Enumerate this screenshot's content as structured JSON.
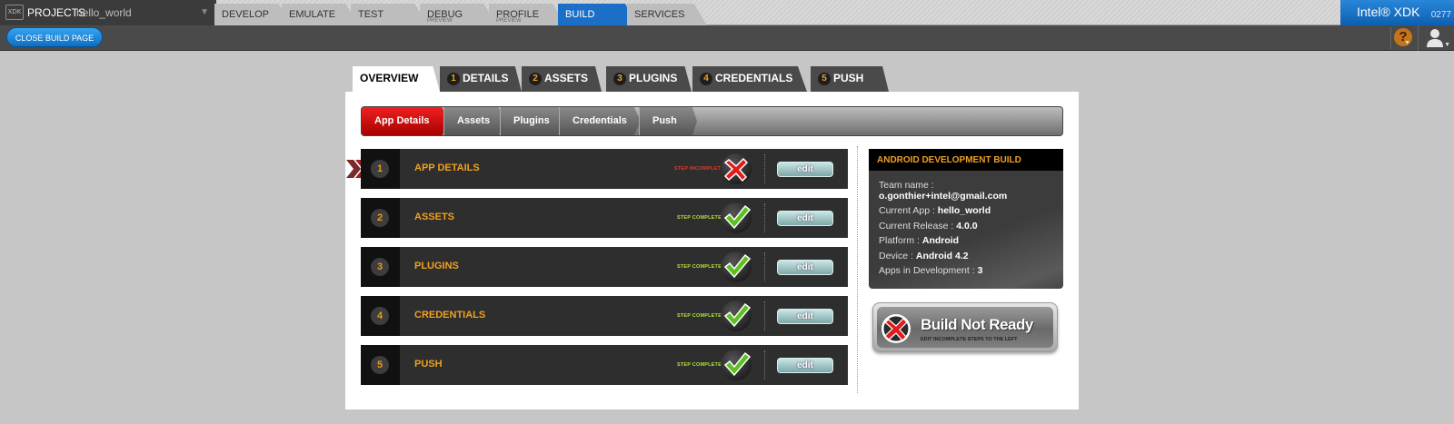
{
  "topbar": {
    "logo_text": "XDK",
    "projects_label": "PROJECTS",
    "project_name": "hello_world",
    "tabs": [
      {
        "label": "DEVELOP",
        "sub": ""
      },
      {
        "label": "EMULATE",
        "sub": ""
      },
      {
        "label": "TEST",
        "sub": ""
      },
      {
        "label": "DEBUG",
        "sub": "PREVIEW"
      },
      {
        "label": "PROFILE",
        "sub": "PREVIEW"
      },
      {
        "label": "BUILD",
        "sub": ""
      },
      {
        "label": "SERVICES",
        "sub": ""
      }
    ],
    "active_tab": "BUILD",
    "brand": "Intel® XDK",
    "version": "0277"
  },
  "toolbar": {
    "close_label": "CLOSE BUILD PAGE",
    "help_glyph": "?",
    "help_icon": "help-icon",
    "user_icon": "user-icon"
  },
  "wizard_tabs": [
    {
      "num": "",
      "label": "OVERVIEW"
    },
    {
      "num": "1",
      "label": "DETAILS"
    },
    {
      "num": "2",
      "label": "ASSETS"
    },
    {
      "num": "3",
      "label": "PLUGINS"
    },
    {
      "num": "4",
      "label": "CREDENTIALS"
    },
    {
      "num": "5",
      "label": "PUSH"
    }
  ],
  "breadcrumb": [
    "App Details",
    "Assets",
    "Plugins",
    "Credentials",
    "Push"
  ],
  "steps": [
    {
      "num": "1",
      "title": "APP DETAILS",
      "status": "STEP INCOMPLETE",
      "complete": false,
      "edit": "edit"
    },
    {
      "num": "2",
      "title": "ASSETS",
      "status": "STEP COMPLETE",
      "complete": true,
      "edit": "edit"
    },
    {
      "num": "3",
      "title": "PLUGINS",
      "status": "STEP COMPLETE",
      "complete": true,
      "edit": "edit"
    },
    {
      "num": "4",
      "title": "CREDENTIALS",
      "status": "STEP COMPLETE",
      "complete": true,
      "edit": "edit"
    },
    {
      "num": "5",
      "title": "PUSH",
      "status": "STEP COMPLETE",
      "complete": true,
      "edit": "edit"
    }
  ],
  "info": {
    "heading": "ANDROID DEVELOPMENT BUILD",
    "team_label": "Team name :",
    "team_value": "o.gonthier+intel@gmail.com",
    "app_label": "Current App :",
    "app_value": "hello_world",
    "release_label": "Current Release :",
    "release_value": "4.0.0",
    "platform_label": "Platform :",
    "platform_value": "Android",
    "device_label": "Device :",
    "device_value": "Android 4.2",
    "apps_label": "Apps in Development :",
    "apps_value": "3"
  },
  "build_button": {
    "title": "Build Not Ready",
    "subtitle": "EDIT INCOMPLETE STEPS TO THE LEFT"
  },
  "colors": {
    "accent_blue": "#1b6fc7",
    "step_orange": "#f0a020",
    "incomplete_red": "#e03a2a",
    "complete_green": "#b6e23a"
  }
}
